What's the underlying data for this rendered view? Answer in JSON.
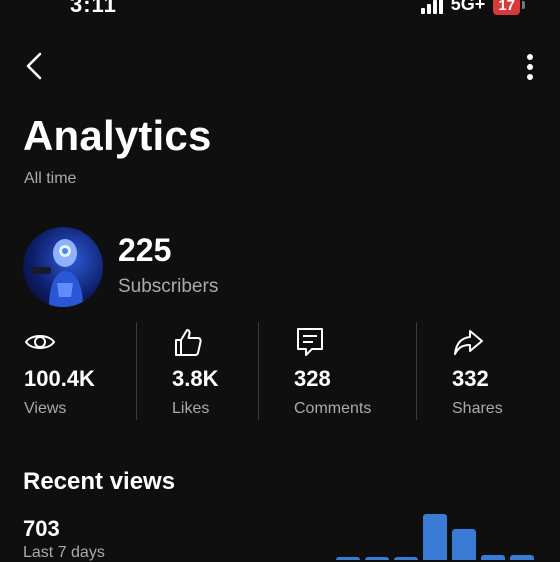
{
  "status_bar": {
    "time": "3:11",
    "network": "5G+",
    "battery": "17"
  },
  "header": {
    "back_icon": "chevron-left-icon",
    "more_icon": "more-vert-icon"
  },
  "page": {
    "title": "Analytics",
    "subtitle": "All time"
  },
  "channel": {
    "subscribers_value": "225",
    "subscribers_label": "Subscribers"
  },
  "stats": [
    {
      "icon": "eye-icon",
      "value": "100.4K",
      "label": "Views"
    },
    {
      "icon": "thumbs-up-icon",
      "value": "3.8K",
      "label": "Likes"
    },
    {
      "icon": "comment-icon",
      "value": "328",
      "label": "Comments"
    },
    {
      "icon": "share-icon",
      "value": "332",
      "label": "Shares"
    }
  ],
  "recent": {
    "title": "Recent views",
    "value": "703",
    "period": "Last 7 days"
  },
  "colors": {
    "background": "#0f0f0f",
    "text_primary": "#ffffff",
    "text_secondary": "#aaaaaa",
    "bar": "#3a7bd5",
    "battery": "#d63a3a"
  },
  "chart_data": {
    "type": "bar",
    "values": [
      2,
      2,
      2,
      45,
      30,
      5,
      5
    ]
  }
}
